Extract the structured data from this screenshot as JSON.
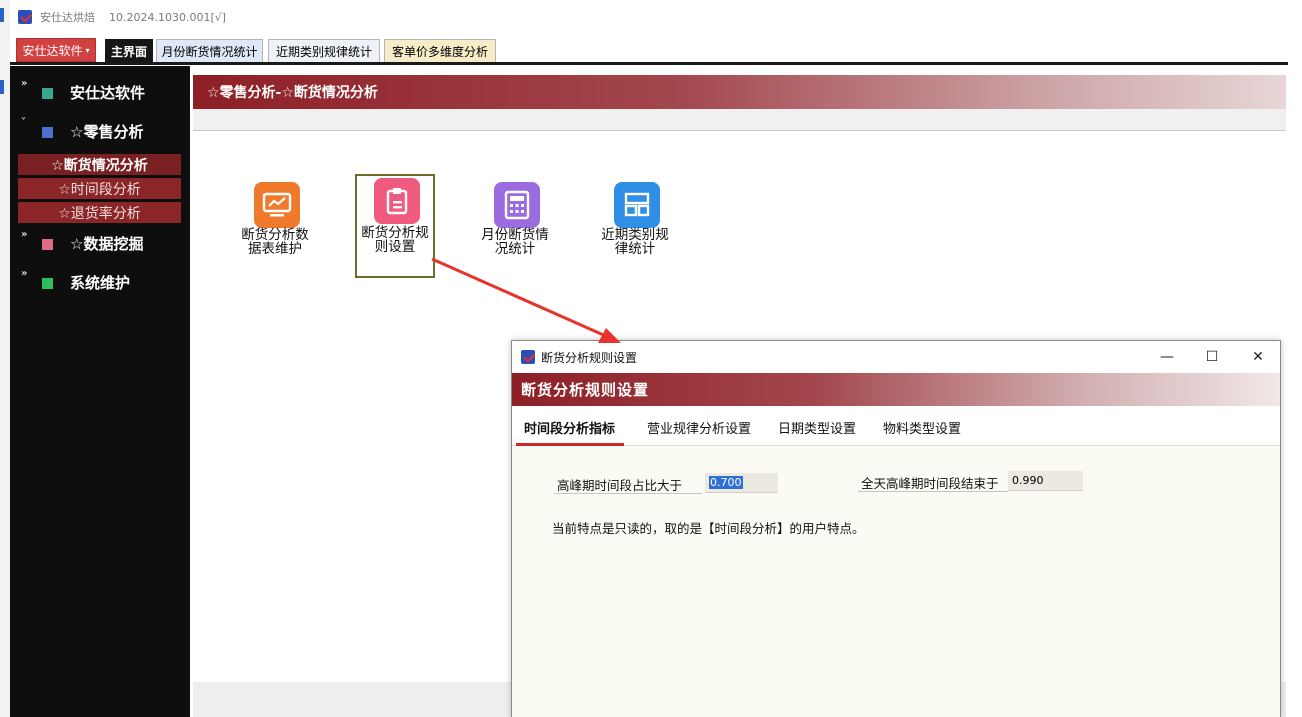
{
  "window": {
    "title": "安仕达烘焙",
    "version": "10.2024.1030.001[√]"
  },
  "menu_button": {
    "label": "安仕达软件"
  },
  "tabs": [
    {
      "label": "主界面"
    },
    {
      "label": "月份断货情况统计"
    },
    {
      "label": "近期类别规律统计"
    },
    {
      "label": "客单价多维度分析"
    }
  ],
  "sidebar": {
    "groups": [
      {
        "label": "安仕达软件",
        "chevron": "»",
        "icon": "teal-square-icon"
      },
      {
        "label": "☆零售分析",
        "chevron": "˅",
        "icon": "blue-square-icon"
      },
      {
        "label": "☆数据挖掘",
        "chevron": "»",
        "icon": "pink-square-icon"
      },
      {
        "label": "系统维护",
        "chevron": "»",
        "icon": "green-square-icon"
      }
    ],
    "subitems": [
      {
        "label": "☆断货情况分析"
      },
      {
        "label": "☆时间段分析"
      },
      {
        "label": "☆退货率分析"
      }
    ]
  },
  "main": {
    "header": "☆零售分析-☆断货情况分析",
    "tiles": [
      {
        "line1": "断货分析数",
        "line2": "据表维护",
        "icon": "chart-monitor-icon",
        "color": "#f07a2c"
      },
      {
        "line1": "断货分析规",
        "line2": "则设置",
        "icon": "clipboard-icon",
        "color": "#ef5a7e"
      },
      {
        "line1": "月份断货情",
        "line2": "况统计",
        "icon": "calculator-icon",
        "color": "#9b6be0"
      },
      {
        "line1": "近期类别规",
        "line2": "律统计",
        "icon": "layout-icon",
        "color": "#2f8ee6"
      }
    ]
  },
  "dialog": {
    "title": "断货分析规则设置",
    "header": "断货分析规则设置",
    "tabs": [
      {
        "label": "时间段分析指标"
      },
      {
        "label": "营业规律分析设置"
      },
      {
        "label": "日期类型设置"
      },
      {
        "label": "物料类型设置"
      }
    ],
    "fields": {
      "peak_ratio_label": "高峰期时间段占比大于",
      "peak_ratio_value": "0.700",
      "allday_end_label": "全天高峰期时间段结束于",
      "allday_end_value": "0.990"
    },
    "note": "当前特点是只读的，取的是【时间段分析】的用户特点。",
    "controls": {
      "minimize": "—",
      "maximize": "☐",
      "close": "✕"
    }
  },
  "colors": {
    "accent_red": "#8d1f25",
    "menu_red": "#d24141",
    "sidebar_bg": "#0e0e0e",
    "arrow": "#e8322c"
  }
}
